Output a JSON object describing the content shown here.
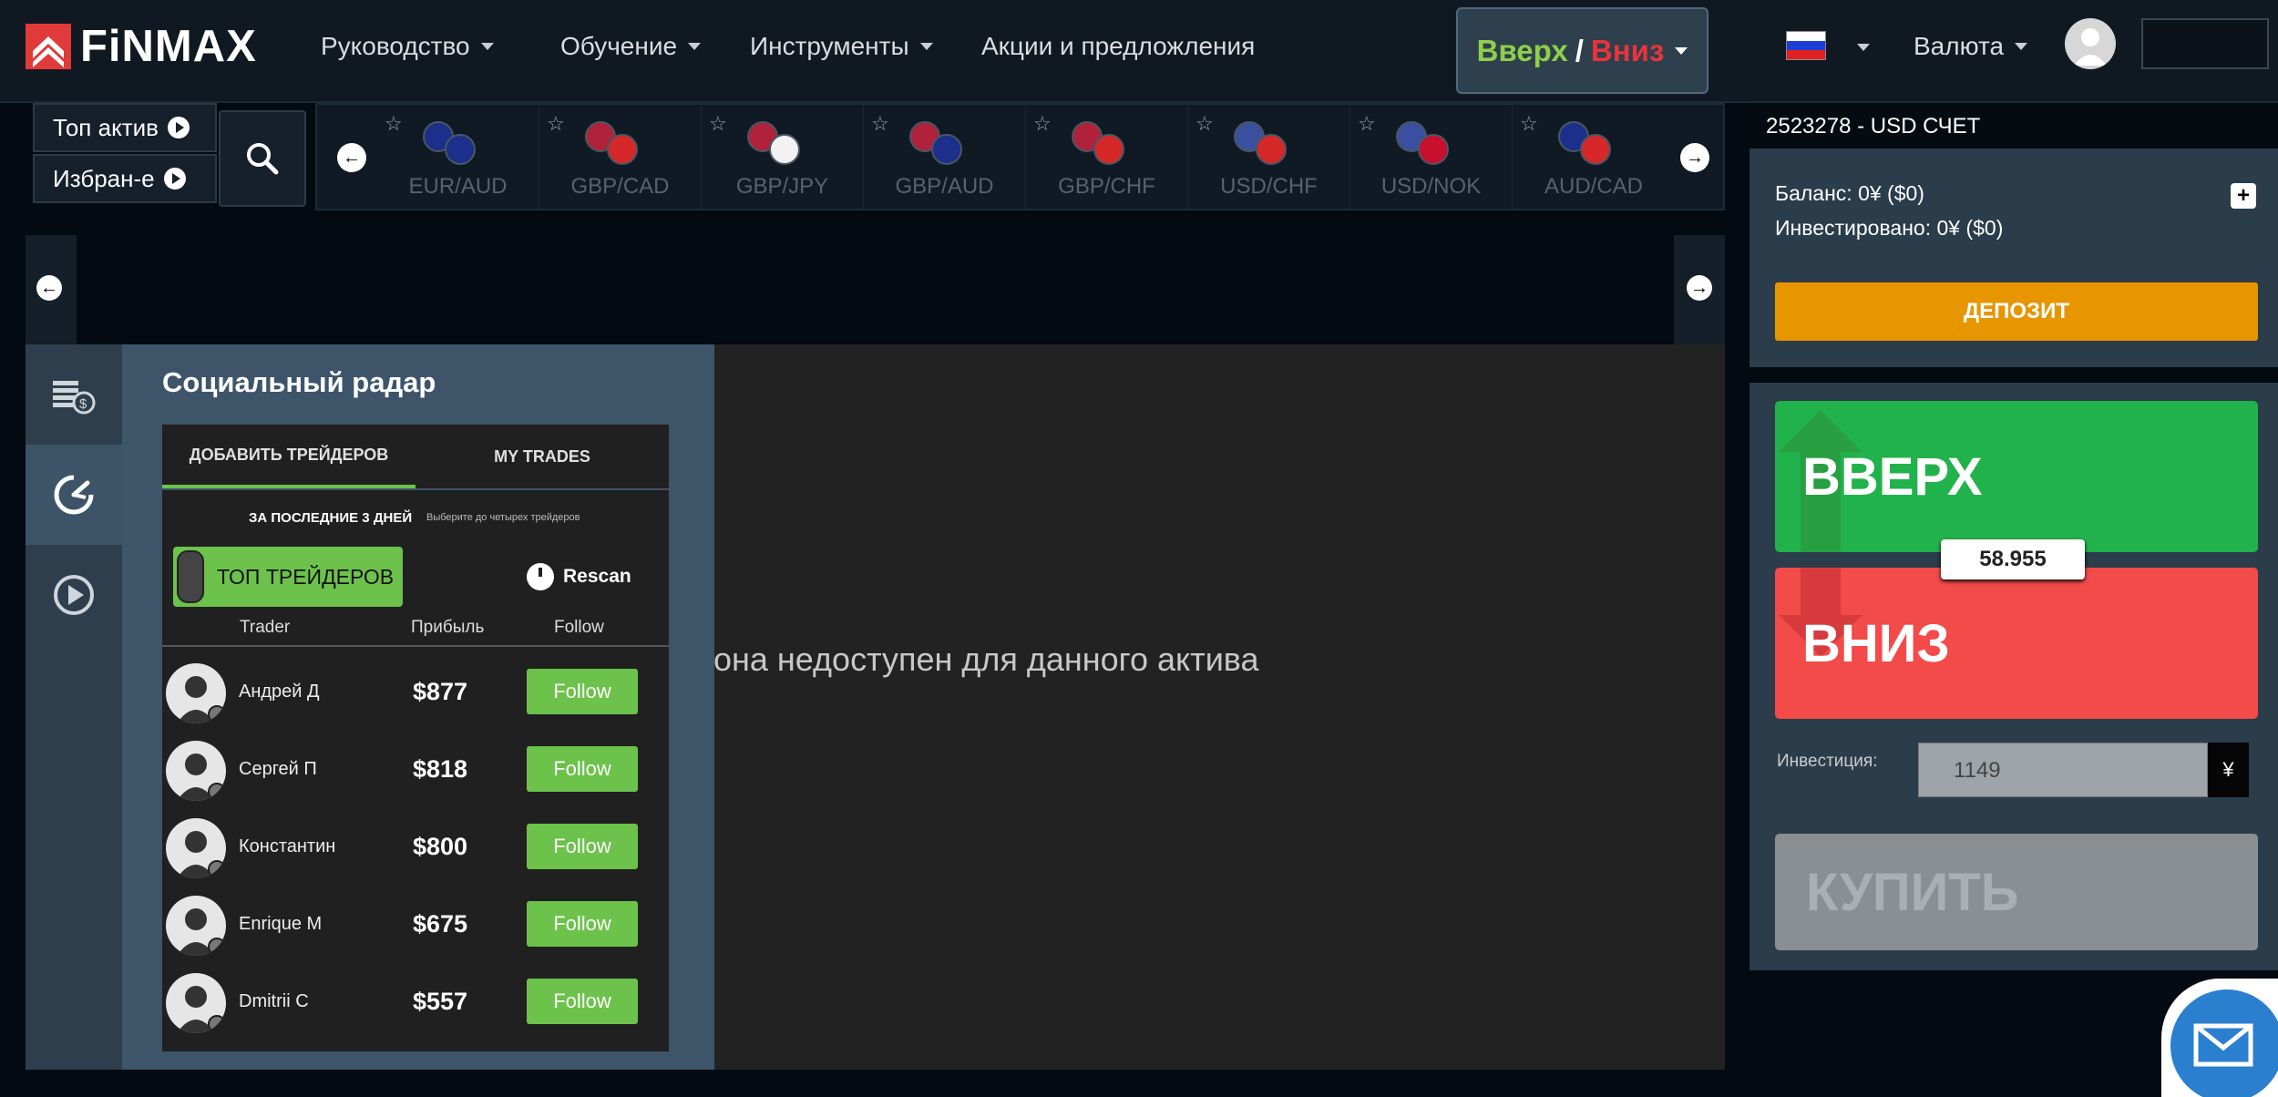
{
  "header": {
    "logo_text": "FiNMAX",
    "nav": [
      "Руководство",
      "Обучение",
      "Инструменты",
      "Акции и предложления"
    ],
    "updown": {
      "up": "Вверх",
      "sep": "/",
      "down": "Вниз"
    },
    "currency_label": "Валюта"
  },
  "assets": {
    "top_label": "Топ актив",
    "fav_label": "Избран-е",
    "pairs": [
      "EUR/AUD",
      "GBP/CAD",
      "GBP/JPY",
      "GBP/AUD",
      "GBP/CHF",
      "USD/CHF",
      "USD/NOK",
      "AUD/CAD"
    ]
  },
  "chart": {
    "unavailable_text": "она недоступен для данного актива"
  },
  "radar": {
    "title": "Социальный радар",
    "tabs": [
      "ДОБАВИТЬ ТРЕЙДЕРОВ",
      "MY TRADES"
    ],
    "period": "ЗА ПОСЛЕДНИЕ 3 ДНЕЙ",
    "choose_hint": "Выберите до четырех трейдеров",
    "top_button": "ТОП ТРЕЙДЕРОВ",
    "rescan": "Rescan",
    "columns": {
      "trader": "Trader",
      "profit": "Прибыль",
      "follow": "Follow"
    },
    "traders": [
      {
        "name": "Андрей Д",
        "profit": "$877",
        "action": "Follow"
      },
      {
        "name": "Сергей П",
        "profit": "$818",
        "action": "Follow"
      },
      {
        "name": "Константин",
        "profit": "$800",
        "action": "Follow"
      },
      {
        "name": "Enrique M",
        "profit": "$675",
        "action": "Follow"
      },
      {
        "name": "Dmitrii C",
        "profit": "$557",
        "action": "Follow"
      }
    ]
  },
  "account": {
    "number": "2523278 - USD СЧЕТ",
    "balance": "Баланс: 0¥ ($0)",
    "invested": "Инвестировано: 0¥ ($0)",
    "deposit": "ДЕПОЗИТ"
  },
  "trade": {
    "up": "ВВЕРХ",
    "down": "ВНИЗ",
    "price": "58.955",
    "investment_label": "Инвестиция:",
    "investment_value": "1149",
    "currency_symbol": "¥",
    "buy": "КУПИТЬ"
  },
  "colors": {
    "accent_green": "#6cc24a",
    "up_green": "#22b24c",
    "down_red": "#f34a4a",
    "deposit_orange": "#e89600"
  }
}
